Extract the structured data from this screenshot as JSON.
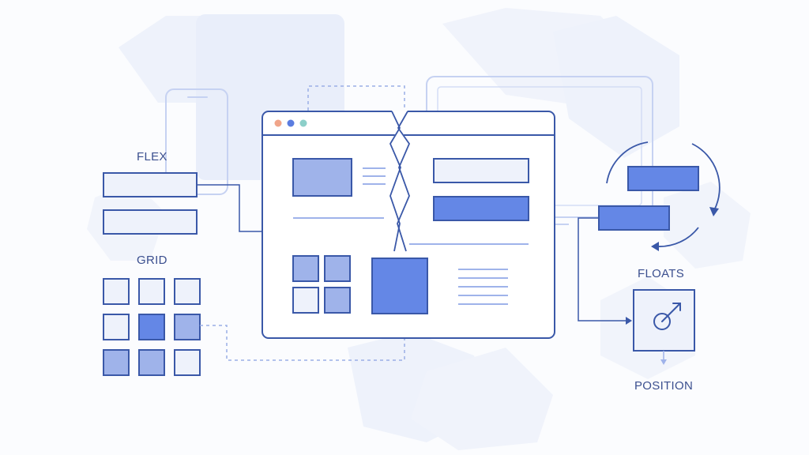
{
  "labels": {
    "flex": "FLEX",
    "grid": "GRID",
    "floats": "FLOATS",
    "position": "POSITION"
  },
  "colors": {
    "stroke": "#3a58a8",
    "fill_medium": "#9fb3ea",
    "fill_strong": "#6487e6",
    "fill_light": "#eef2fb",
    "faint_line": "#b7c5ee",
    "dot_red": "#f0a58a",
    "dot_blue": "#5b7de0",
    "dot_teal": "#8ccfc9"
  },
  "grid_cells": [
    "light",
    "light",
    "light",
    "light",
    "strong",
    "medium",
    "medium",
    "medium",
    "light"
  ],
  "icons": {
    "browser": "browser-window-icon",
    "phone": "phone-outline-icon",
    "monitor": "monitor-outline-icon",
    "target": "target-arrow-icon"
  }
}
